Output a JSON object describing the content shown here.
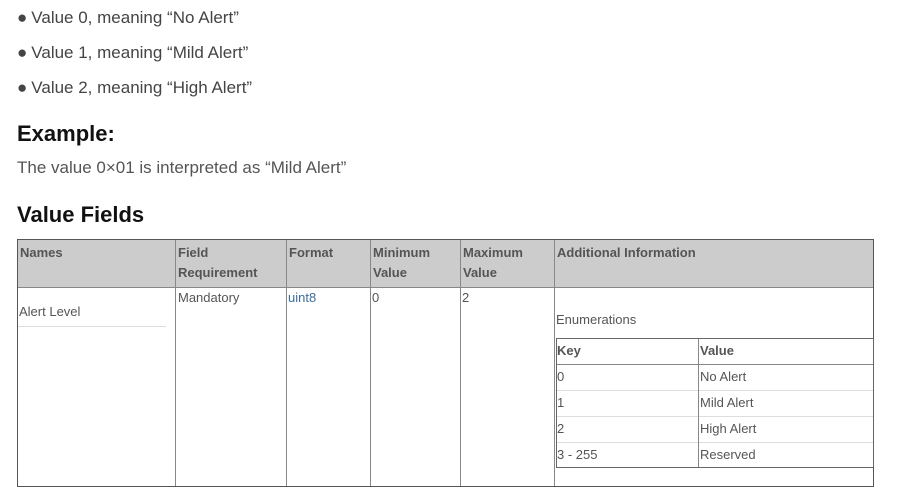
{
  "bullets": [
    "Value 0, meaning “No Alert”",
    "Value 1, meaning “Mild Alert”",
    "Value 2, meaning “High Alert”"
  ],
  "bullet_symbol": "●",
  "example": {
    "heading": "Example:",
    "text": "The value 0×01 is interpreted as “Mild Alert”"
  },
  "value_fields": {
    "heading": "Value Fields",
    "headers": {
      "names": "Names",
      "field_requirement_1": "Field",
      "field_requirement_2": "Requirement",
      "format": "Format",
      "minimum_1": "Minimum",
      "minimum_2": "Value",
      "maximum_1": "Maximum",
      "maximum_2": "Value",
      "additional": "Additional Information"
    },
    "row": {
      "name": "Alert Level",
      "requirement": "Mandatory",
      "format": "uint8",
      "minimum": "0",
      "maximum": "2",
      "enum_caption": "Enumerations"
    },
    "enum": {
      "key_header": "Key",
      "value_header": "Value",
      "rows": [
        {
          "key": "0",
          "value": "No Alert"
        },
        {
          "key": "1",
          "value": "Mild Alert"
        },
        {
          "key": "2",
          "value": "High Alert"
        },
        {
          "key": "3 - 255",
          "value": "Reserved"
        }
      ]
    }
  },
  "colors": {
    "header_bg": "#cccccc",
    "link": "#3a6e9a"
  }
}
